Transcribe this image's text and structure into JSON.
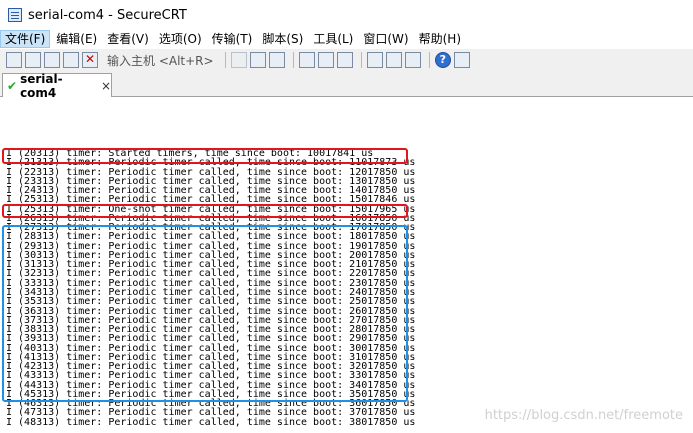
{
  "window": {
    "title": "serial-com4 - SecureCRT"
  },
  "menu": [
    "文件(F)",
    "编辑(E)",
    "查看(V)",
    "选项(O)",
    "传输(T)",
    "脚本(S)",
    "工具(L)",
    "窗口(W)",
    "帮助(H)"
  ],
  "toolbar": {
    "host_input_label": "输入主机 <Alt+R>",
    "icons": [
      "connect-icon",
      "quick-connect-icon",
      "connect-tab-icon",
      "reconnect-icon",
      "disconnect-icon",
      "copy-icon",
      "paste-icon",
      "find-icon",
      "print-setup-icon",
      "print-icon",
      "print-selection-icon",
      "session-options-icon",
      "global-options-icon",
      "keymap-icon",
      "help-icon",
      "sftp-icon"
    ]
  },
  "tab": {
    "label": "serial-com4",
    "close": "×"
  },
  "terminal": {
    "lines": [
      "I (20313) timer: Started timers, time since boot: 10017841 us",
      "I (21313) timer: Periodic timer called, time since boot: 11017873 us",
      "I (22313) timer: Periodic timer called, time since boot: 12017850 us",
      "I (23313) timer: Periodic timer called, time since boot: 13017850 us",
      "I (24313) timer: Periodic timer called, time since boot: 14017850 us",
      "I (25313) timer: Periodic timer called, time since boot: 15017846 us",
      "I (25313) timer: One-shot timer called, time since boot: 15017965 us",
      "I (26313) timer: Periodic timer called, time since boot: 16017850 us",
      "I (27313) timer: Periodic timer called, time since boot: 17017850 us",
      "I (28313) timer: Periodic timer called, time since boot: 18017850 us",
      "I (29313) timer: Periodic timer called, time since boot: 19017850 us",
      "I (30313) timer: Periodic timer called, time since boot: 20017850 us",
      "I (31313) timer: Periodic timer called, time since boot: 21017850 us",
      "I (32313) timer: Periodic timer called, time since boot: 22017850 us",
      "I (33313) timer: Periodic timer called, time since boot: 23017850 us",
      "I (34313) timer: Periodic timer called, time since boot: 24017850 us",
      "I (35313) timer: Periodic timer called, time since boot: 25017850 us",
      "I (36313) timer: Periodic timer called, time since boot: 26017850 us",
      "I (37313) timer: Periodic timer called, time since boot: 27017850 us",
      "I (38313) timer: Periodic timer called, time since boot: 28017850 us",
      "I (39313) timer: Periodic timer called, time since boot: 29017850 us",
      "I (40313) timer: Periodic timer called, time since boot: 30017850 us",
      "I (41313) timer: Periodic timer called, time since boot: 31017850 us",
      "I (42313) timer: Periodic timer called, time since boot: 32017850 us",
      "I (43313) timer: Periodic timer called, time since boot: 33017850 us",
      "I (44313) timer: Periodic timer called, time since boot: 34017850 us",
      "I (45313) timer: Periodic timer called, time since boot: 35017850 us",
      "I (46313) timer: Periodic timer called, time since boot: 36017850 us",
      "I (47313) timer: Periodic timer called, time since boot: 37017850 us",
      "I (48313) timer: Periodic timer called, time since boot: 38017850 us"
    ]
  },
  "watermark": "https://blog.csdn.net/freemote",
  "colors": {
    "highlight_red": "#e0161b",
    "highlight_blue": "#1e90e6",
    "menu_active": "#cce4f7"
  }
}
